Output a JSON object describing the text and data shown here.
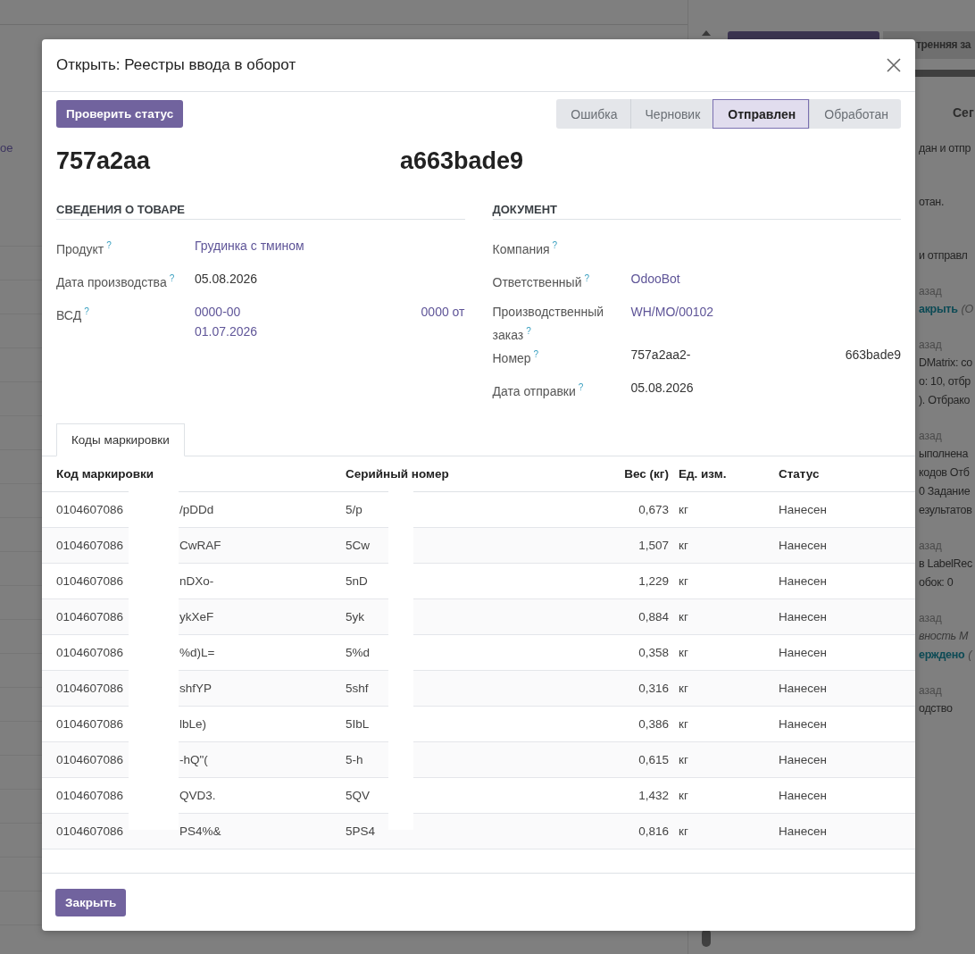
{
  "background": {
    "left_list": {
      "header_fragment": "ое"
    },
    "side_tab": "тренняя за",
    "chatter": {
      "heading": "Сег",
      "messages": [
        {
          "lines": [
            {
              "kind": "text",
              "text": "дан и отпр"
            }
          ]
        },
        {
          "lines": [
            {
              "kind": "text",
              "text": "отан."
            }
          ]
        },
        {
          "lines": [
            {
              "kind": "text",
              "text": "и отправл"
            }
          ]
        },
        {
          "meta": "азад",
          "lines": [
            {
              "kind": "action",
              "text": "акрыть",
              "note": "(О"
            }
          ]
        },
        {
          "meta": "азад",
          "lines": [
            {
              "kind": "text",
              "text": "DMatrix: co"
            },
            {
              "kind": "text",
              "text": "о: 10, отбр"
            },
            {
              "kind": "text",
              "text": "). Отбрако"
            }
          ]
        },
        {
          "meta": "азад",
          "lines": [
            {
              "kind": "text",
              "text": "ыполнена"
            },
            {
              "kind": "text",
              "text": "кодов Отб"
            },
            {
              "kind": "text",
              "text": "0 Задание"
            },
            {
              "kind": "text",
              "text": "езультатов"
            }
          ]
        },
        {
          "meta": "азад",
          "lines": [
            {
              "kind": "text",
              "text": "в LabelRec"
            },
            {
              "kind": "text",
              "text": "обок: 0"
            }
          ]
        },
        {
          "meta": "азад",
          "lines": [
            {
              "kind": "italic",
              "text": "вность М"
            },
            {
              "kind": "action",
              "text": "ерждено",
              "note": "("
            }
          ]
        },
        {
          "meta": "азад",
          "lines": [
            {
              "kind": "text",
              "text": "одство"
            }
          ]
        }
      ]
    }
  },
  "dialog": {
    "title": "Открыть: Реестры ввода в оборот",
    "check_button": "Проверить статус",
    "status_steps": [
      {
        "label": "Ошибка",
        "selected": false
      },
      {
        "label": "Черновик",
        "selected": false
      },
      {
        "label": "Отправлен",
        "selected": true
      },
      {
        "label": "Обработан",
        "selected": false
      }
    ],
    "record_name": [
      "757a2aa",
      "a663bade9"
    ],
    "product_section": {
      "title": "СВЕДЕНИЯ О ТОВАРЕ",
      "fields": [
        {
          "label": "Продукт",
          "help": "?",
          "kind": "link",
          "parts": [
            "Грудинка с тмином"
          ]
        },
        {
          "label": "Дата производства",
          "help": "?",
          "kind": "text",
          "parts": [
            "05.08.2026"
          ]
        },
        {
          "label": "ВСД",
          "help": "?",
          "kind": "link",
          "parts": [
            "0000-00",
            "0000 от",
            "01.07.2026"
          ]
        }
      ]
    },
    "document_section": {
      "title": "ДОКУМЕНТ",
      "fields": [
        {
          "label": "Компания",
          "help": "?",
          "kind": "text"
        },
        {
          "label": "Ответственный",
          "help": "?",
          "kind": "link",
          "parts": [
            "OdooBot"
          ]
        },
        {
          "label": "Производственный заказ",
          "help": "?",
          "kind": "link",
          "parts": [
            "WH/MO/00102"
          ]
        },
        {
          "label": "Номер",
          "help": "?",
          "kind": "text",
          "parts": [
            "757a2aa2-",
            "663bade9"
          ]
        },
        {
          "label": "Дата отправки",
          "help": "?",
          "kind": "text",
          "parts": [
            "05.08.2026"
          ]
        }
      ]
    },
    "tabs": [
      {
        "label": "Коды маркировки",
        "selected": true
      }
    ],
    "table": {
      "columns": [
        "Код маркировки",
        "Серийный номер",
        "Вес (кг)",
        "Ед. изм.",
        "Статус"
      ],
      "rows": [
        {
          "code": [
            "0104607086",
            "/pDDd"
          ],
          "serial": "5/p",
          "weight": "0,673",
          "unit": "кг",
          "status": "Нанесен"
        },
        {
          "code": [
            "0104607086",
            "CwRAF"
          ],
          "serial": "5Cw",
          "weight": "1,507",
          "unit": "кг",
          "status": "Нанесен"
        },
        {
          "code": [
            "0104607086",
            "nDXo-"
          ],
          "serial": "5nD",
          "weight": "1,229",
          "unit": "кг",
          "status": "Нанесен"
        },
        {
          "code": [
            "0104607086",
            "ykXeF"
          ],
          "serial": "5yk",
          "weight": "0,884",
          "unit": "кг",
          "status": "Нанесен"
        },
        {
          "code": [
            "0104607086",
            "%d)L="
          ],
          "serial": "5%d",
          "weight": "0,358",
          "unit": "кг",
          "status": "Нанесен"
        },
        {
          "code": [
            "0104607086",
            "shfYP"
          ],
          "serial": "5shf",
          "weight": "0,316",
          "unit": "кг",
          "status": "Нанесен"
        },
        {
          "code": [
            "0104607086",
            "lbLe)"
          ],
          "serial": "5IbL",
          "weight": "0,386",
          "unit": "кг",
          "status": "Нанесен"
        },
        {
          "code": [
            "0104607086",
            "-hQ\"("
          ],
          "serial": "5-h",
          "weight": "0,615",
          "unit": "кг",
          "status": "Нанесен"
        },
        {
          "code": [
            "0104607086",
            "QVD3."
          ],
          "serial": "5QV",
          "weight": "1,432",
          "unit": "кг",
          "status": "Нанесен"
        },
        {
          "code": [
            "0104607086",
            "PS4%&"
          ],
          "serial": "5PS4",
          "weight": "0,816",
          "unit": "кг",
          "status": "Нанесен"
        }
      ]
    },
    "close_button": "Закрыть"
  }
}
